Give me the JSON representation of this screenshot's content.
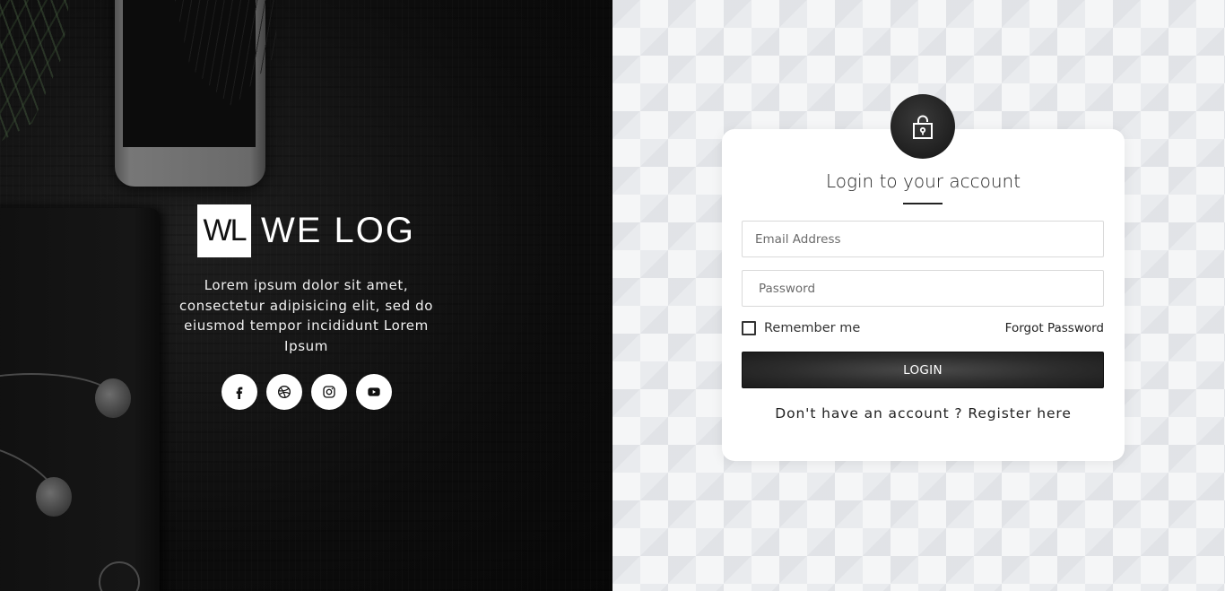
{
  "brand": {
    "logo_mark": "WL",
    "name": "WE LOG",
    "tagline": "Lorem ipsum dolor sit amet, consectetur adipisicing elit, sed do eiusmod tempor incididunt Lorem Ipsum"
  },
  "socials": [
    {
      "icon": "facebook-icon"
    },
    {
      "icon": "dribbble-icon"
    },
    {
      "icon": "instagram-icon"
    },
    {
      "icon": "youtube-icon"
    }
  ],
  "login": {
    "title": "Login to your account",
    "lock_icon": "lock-icon",
    "email_placeholder": "Email Address",
    "password_placeholder": "Password",
    "remember_label": "Remember me",
    "forgot_label": "Forgot Password",
    "login_button": "LOGIN",
    "register_text": "Don't have an account ? Register here"
  },
  "colors": {
    "left_bg": "#0d0d0d",
    "right_bg": "#e9ebee",
    "card_bg": "#ffffff",
    "button_bg": "#2c2c2c"
  }
}
